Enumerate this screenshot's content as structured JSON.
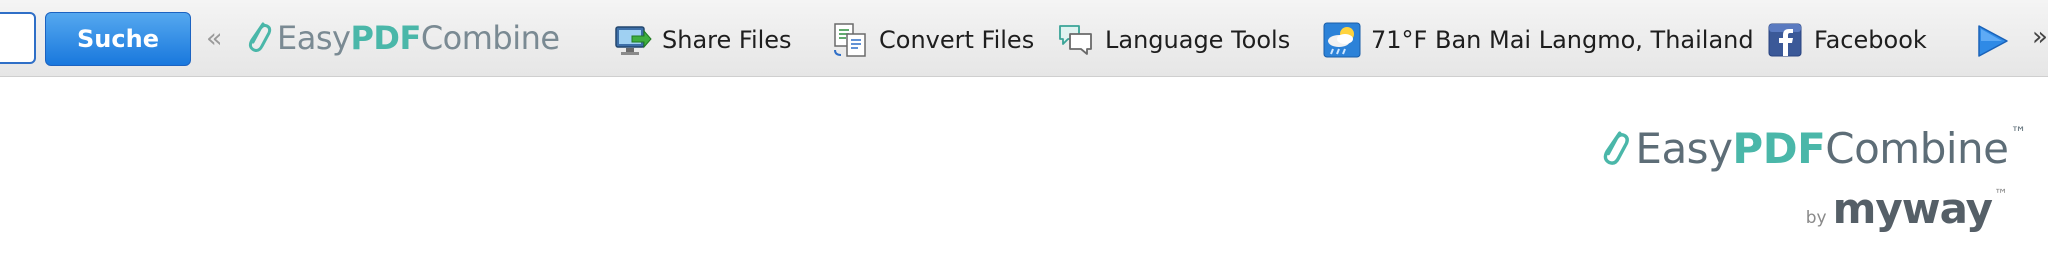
{
  "toolbar": {
    "search": {
      "value": "",
      "button_label": "Suche"
    },
    "left_chevron": "«",
    "brand": {
      "part1": "Easy",
      "part2": "PDF",
      "part3": "Combine"
    },
    "items": [
      {
        "label": "Share Files",
        "icon": "share-files-icon"
      },
      {
        "label": "Convert Files",
        "icon": "convert-files-icon"
      },
      {
        "label": "Language Tools",
        "icon": "language-tools-icon"
      },
      {
        "label": "71°F Ban Mai Langmo, Thailand",
        "icon": "weather-icon"
      },
      {
        "label": "Facebook",
        "icon": "facebook-icon"
      }
    ],
    "more": "»"
  },
  "page_logo": {
    "part1": "Easy",
    "part2": "PDF",
    "part3": "Combine",
    "tm": "™",
    "by": "by",
    "myway": "myway",
    "myway_tm": "™"
  },
  "colors": {
    "accent_blue": "#1978dd",
    "brand_teal": "#4ab7a9",
    "brand_gray": "#5d6d77"
  }
}
